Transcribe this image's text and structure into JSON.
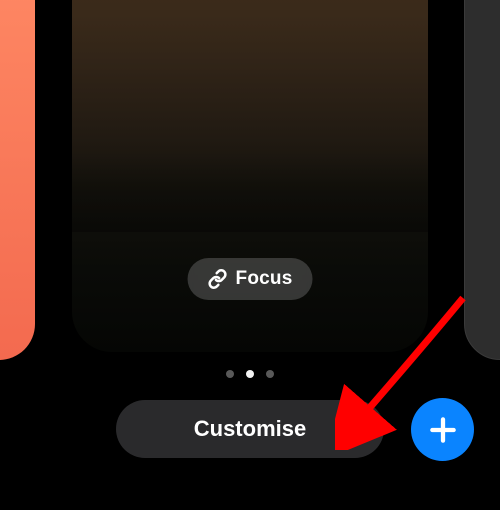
{
  "cards": {
    "prev": {
      "gradient_top": "#ff8a65",
      "gradient_bottom": "#f36a4f"
    },
    "main": {
      "theme": "dusk-landscape"
    },
    "next": {
      "background": "#2d2d2d"
    }
  },
  "focus": {
    "label": "Focus",
    "icon": "link-icon"
  },
  "pager": {
    "count": 3,
    "active_index": 1
  },
  "customise": {
    "label": "Customise"
  },
  "add_button": {
    "icon": "plus-icon",
    "color": "#0a84ff"
  },
  "annotation": {
    "type": "arrow",
    "color": "#ff0000",
    "points_to": "customise-button"
  }
}
